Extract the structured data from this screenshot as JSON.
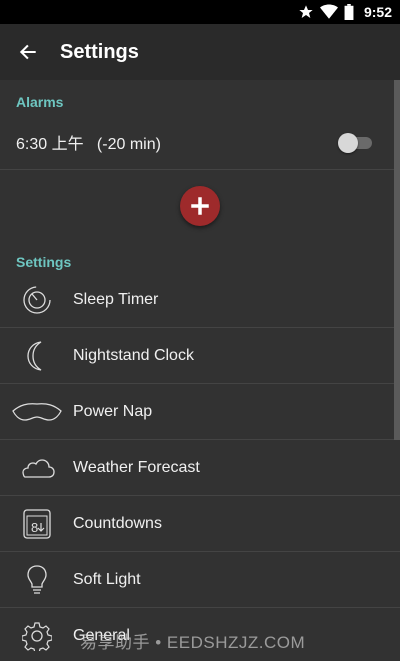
{
  "status_bar": {
    "time": "9:52",
    "icons": [
      "star-icon",
      "wifi-icon",
      "battery-icon"
    ]
  },
  "app_bar": {
    "title": "Settings",
    "back_icon": "arrow-left-icon"
  },
  "alarms": {
    "header": "Alarms",
    "items": [
      {
        "label": "6:30 上午   (-20 min)",
        "enabled": false
      }
    ]
  },
  "add_button": {
    "icon": "plus-icon",
    "label": "+"
  },
  "settings": {
    "header": "Settings",
    "items": [
      {
        "label": "Sleep Timer",
        "icon": "sleep-timer-icon"
      },
      {
        "label": "Nightstand Clock",
        "icon": "moon-icon"
      },
      {
        "label": "Power Nap",
        "icon": "sleep-mask-icon"
      },
      {
        "label": "Weather Forecast",
        "icon": "cloud-icon"
      },
      {
        "label": "Countdowns",
        "icon": "calendar-icon"
      },
      {
        "label": "Soft Light",
        "icon": "lightbulb-icon"
      },
      {
        "label": "General",
        "icon": "gear-icon"
      }
    ]
  },
  "watermark": "易享助手 • EEDSHZJZ.COM",
  "colors": {
    "accent": "#6ec6c1",
    "fab": "#9e2a2b",
    "background": "#323232",
    "app_bar": "#2a2a2a"
  }
}
